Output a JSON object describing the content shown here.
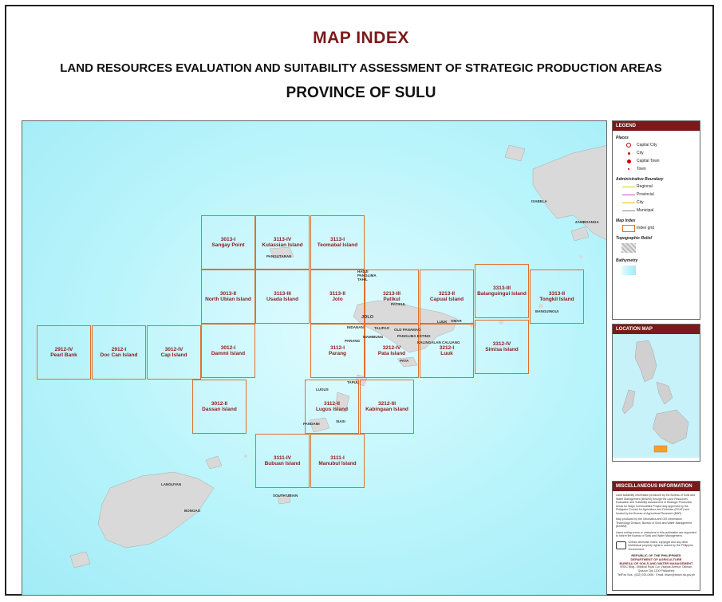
{
  "header": {
    "title": "MAP INDEX",
    "subtitle": "LAND RESOURCES EVALUATION AND SUITABILITY ASSESSMENT OF STRATEGIC PRODUCTION AREAS",
    "province": "PROVINCE OF SULU"
  },
  "tiles": [
    {
      "code": "3013-I",
      "name": "Sangay Point"
    },
    {
      "code": "3113-IV",
      "name": "Kulassian Island"
    },
    {
      "code": "3113-I",
      "name": "Teomabal Island"
    },
    {
      "code": "3013-II",
      "name": "North Ubian Island"
    },
    {
      "code": "3113-III",
      "name": "Usada Island"
    },
    {
      "code": "3113-II",
      "name": "Jolo"
    },
    {
      "code": "3213-III",
      "name": "Patikul"
    },
    {
      "code": "3213-II",
      "name": "Capual Island"
    },
    {
      "code": "3313-III",
      "name": "Balanguingui Island"
    },
    {
      "code": "3313-II",
      "name": "Tongkil Island"
    },
    {
      "code": "2912-IV",
      "name": "Pearl Bank"
    },
    {
      "code": "2912-I",
      "name": "Doc Can Island"
    },
    {
      "code": "3012-IV",
      "name": "Cap Island"
    },
    {
      "code": "3012-I",
      "name": "Dammi Island"
    },
    {
      "code": "3112-I",
      "name": "Parang"
    },
    {
      "code": "3212-IV",
      "name": "Pata Island"
    },
    {
      "code": "3212-I",
      "name": "Luuk"
    },
    {
      "code": "3312-IV",
      "name": "Simisa Island"
    },
    {
      "code": "3012-II",
      "name": "Dassan Island"
    },
    {
      "code": "3112-II",
      "name": "Lugus Island"
    },
    {
      "code": "3212-III",
      "name": "Kabingaan Island"
    },
    {
      "code": "3111-IV",
      "name": "Bubuan Island"
    },
    {
      "code": "3111-I",
      "name": "Manubul Island"
    }
  ],
  "places": [
    "JOLO",
    "PATIKUL",
    "INDANAN",
    "TALIPAO",
    "OLD PANAMAO",
    "PARANG",
    "MAIMBUNG",
    "PANGLIMA ESTINO",
    "KALINGALAN CALUANG",
    "LUUK",
    "OMAR",
    "PATA",
    "TAPUL",
    "LUGUS",
    "PANDAMI",
    "SIASI",
    "PANGUTARAN",
    "BANGUINGUI",
    "HADJI PANGLIMA TAHIL",
    "ISABELA",
    "ZAMBOANGA",
    "LANGUYAN",
    "BONGAO",
    "SOUTH UBIAN"
  ],
  "legend": {
    "heading": "LEGEND",
    "places_title": "Places",
    "places": [
      "Capital City",
      "City",
      "Capital Town",
      "Town"
    ],
    "admin_title": "Administrative Boundary",
    "admin": [
      {
        "label": "Regional",
        "color": "#e6d200"
      },
      {
        "label": "Provincial",
        "color": "#d04ad0"
      },
      {
        "label": "City",
        "color": "#f0c000"
      },
      {
        "label": "Municipal",
        "color": "#888888"
      }
    ],
    "mapindex_title": "Map Index",
    "index_label": "Index grid",
    "relief_title": "Topographic Relief",
    "bathy_title": "Bathymetry"
  },
  "location_map": {
    "heading": "LOCATION MAP"
  },
  "misc": {
    "heading": "MISCELLANEOUS INFORMATION",
    "para1": "Land suitability information produced by the Bureau of Soils and Water Management (BSWM) through the Land Resources Evaluation and Suitability Assessment of Strategic Production Areas for Major Commodities Project duly approved by the Philippine Council for Agriculture and Fisheries (PCAF) and funded by the Bureau of Agricultural Research (BAR).",
    "para2": "Map produced by the Geomatics and GIS Information Technology Division, Bureau of Soils and Water Management (BSWM).",
    "para3": "Users noting errors or omissions in this publication are requested to inform the Bureau of Soils and Water Management.",
    "license": "Unless otherwise noted, copyright and any other intellectual property rights is owned by the Philippine Government.",
    "agency1": "REPUBLIC OF THE PHILIPPINES",
    "agency2": "DEPARTMENT OF AGRICULTURE",
    "agency3": "BUREAU OF SOILS AND WATER MANAGEMENT",
    "address": "SRDC Bldg., Elliptical Road Cor. Visayas Avenue, Diliman, Quezon City 1100 Philippines",
    "contact": "Tel/Fax Nos.: (632) 923-0456 · Email: bswm@bswm.da.gov.ph"
  },
  "colors": {
    "accent": "#7a1a1a",
    "grid": "#e0702a",
    "sea": "#b8f4fb",
    "land": "#d9d9d9"
  }
}
